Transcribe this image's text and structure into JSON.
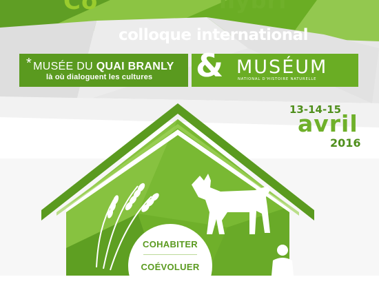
{
  "poster": {
    "title_left_partial": "Co",
    "title_right_partial": "hybri",
    "colloque": "colloque international",
    "partner1_star": "*",
    "partner1_name_a": "MUSÉE DU ",
    "partner1_name_b": "QUAI BRANLY",
    "partner1_tagline": "là où dialoguent les cultures",
    "ampersand": "&",
    "partner2_name": "MUSÉUM",
    "partner2_sub": "NATIONAL D'HISTOIRE NATURELLE",
    "dates": "13-14-15",
    "month": "avril",
    "year": "2016",
    "theme_1": "COHABITER",
    "theme_2": "COÉVOLUER"
  },
  "colors": {
    "green_dark": "#4f8f1c",
    "green_mid": "#6aad24",
    "green_light": "#9acc2e"
  }
}
